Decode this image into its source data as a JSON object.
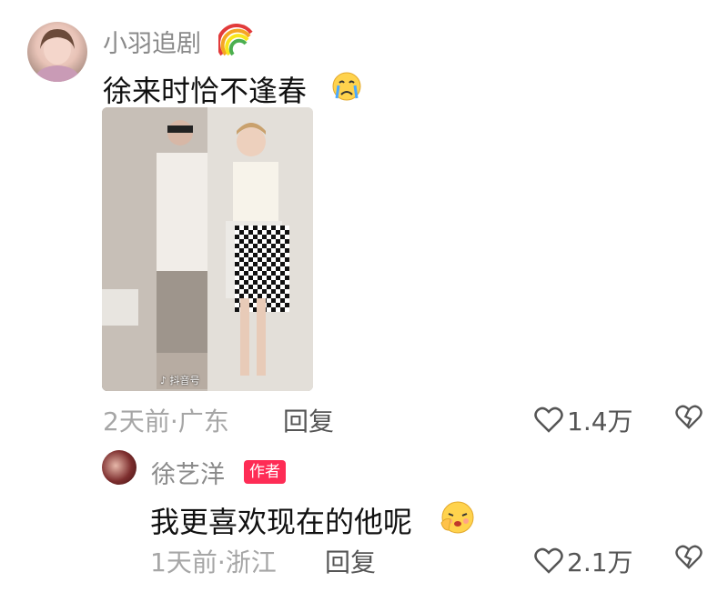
{
  "comment": {
    "username": "小羽追剧",
    "username_emoji": "rainbow",
    "text": "徐来时恰不逢春",
    "text_emoji": "crying-face",
    "photo_watermark": "抖音号",
    "time_location": "2天前·广东",
    "reply_label": "回复",
    "like_count": "1.4万"
  },
  "reply": {
    "username": "徐艺洋",
    "author_badge": "作者",
    "text": "我更喜欢现在的他呢",
    "text_emoji": "shy-face",
    "time_location": "1天前·浙江",
    "reply_label": "回复",
    "like_count": "2.1万"
  },
  "colors": {
    "badge": "#fe2c55",
    "meta": "#a6a6a6",
    "username": "#8a8a8a"
  }
}
